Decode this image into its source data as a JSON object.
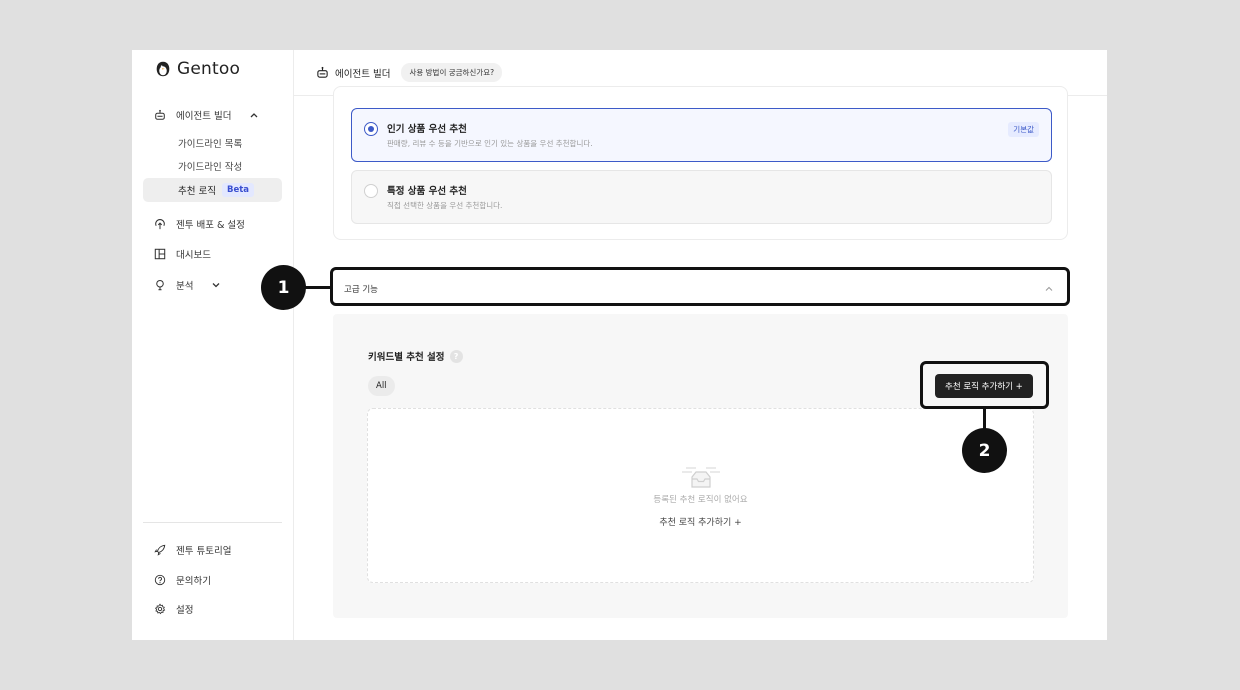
{
  "app": {
    "name": "Gentoo",
    "logo_icon": "penguin-logo-icon"
  },
  "sidebar": {
    "agent_builder": {
      "label": "에이전트 빌더",
      "icon": "robot-icon",
      "expanded": true
    },
    "sub_items": [
      {
        "label": "가이드라인 목록"
      },
      {
        "label": "가이드라인 작성"
      }
    ],
    "active_item": {
      "label": "추천 로직",
      "badge": "Beta"
    },
    "items": [
      {
        "label": "젠투 배포 & 설정",
        "icon": "deploy-upload-icon"
      },
      {
        "label": "대시보드",
        "icon": "dashboard-icon"
      },
      {
        "label": "분석",
        "icon": "lightbulb-icon"
      }
    ],
    "footer_items": [
      {
        "label": "젠투 튜토리얼",
        "icon": "rocket-icon"
      },
      {
        "label": "문의하기",
        "icon": "help-circle-icon"
      },
      {
        "label": "설정",
        "icon": "settings-gear-icon"
      }
    ]
  },
  "topbar": {
    "title": "에이전트 빌더",
    "help_label": "사용 방법이 궁금하신가요?"
  },
  "recommendation_options": [
    {
      "title": "인기 상품 우선 추천",
      "description": "판매량, 리뷰 수 등을 기반으로 인기 있는 상품을 우선 추천합니다.",
      "selected": true,
      "badge": "기본값"
    },
    {
      "title": "특정 상품 우선 추천",
      "description": "직접 선택한 상품을 우선 추천합니다.",
      "selected": false
    }
  ],
  "advanced": {
    "label": "고급 기능",
    "expanded": true
  },
  "keyword_panel": {
    "title": "키워드별 추천 설정",
    "help_icon": "?",
    "filter_chip": "All",
    "add_button": "추천 로직 추가하기 +",
    "empty_message": "등록된 추천 로직이 없어요",
    "empty_link": "추천 로직 추가하기 +"
  },
  "annotations": {
    "marker_1": "1",
    "marker_2": "2"
  },
  "colors": {
    "accent": "#3d5ac8",
    "annotation": "#111111",
    "page_background": "#e0e0e0"
  }
}
